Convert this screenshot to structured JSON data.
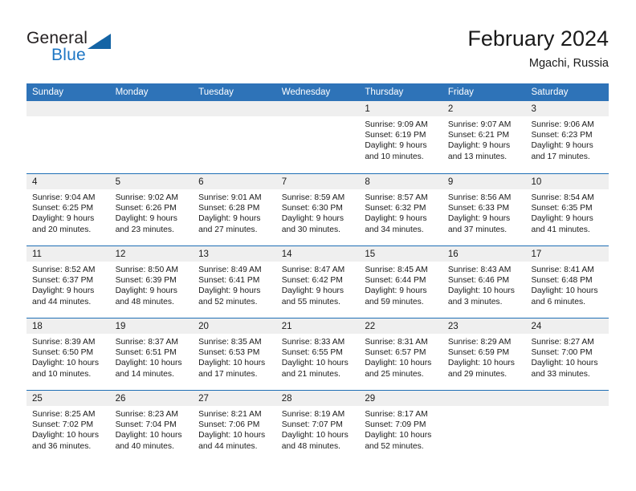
{
  "brand": {
    "name_part1": "General",
    "name_part2": "Blue",
    "triangle_icon": "triangle-icon"
  },
  "header": {
    "title": "February 2024",
    "subtitle": "Mgachi, Russia"
  },
  "colors": {
    "header_blue": "#2e73b8",
    "divider_blue": "#1f6fb5",
    "day_strip_gray": "#efefef",
    "brand_blue": "#1d76c4",
    "text": "#1a1a1a"
  },
  "weekdays": [
    "Sunday",
    "Monday",
    "Tuesday",
    "Wednesday",
    "Thursday",
    "Friday",
    "Saturday"
  ],
  "weeks": [
    [
      {
        "day": "",
        "empty": true,
        "sunrise": "",
        "sunset": "",
        "daylight_line1": "",
        "daylight_line2": ""
      },
      {
        "day": "",
        "empty": true,
        "sunrise": "",
        "sunset": "",
        "daylight_line1": "",
        "daylight_line2": ""
      },
      {
        "day": "",
        "empty": true,
        "sunrise": "",
        "sunset": "",
        "daylight_line1": "",
        "daylight_line2": ""
      },
      {
        "day": "",
        "empty": true,
        "sunrise": "",
        "sunset": "",
        "daylight_line1": "",
        "daylight_line2": ""
      },
      {
        "day": "1",
        "sunrise": "Sunrise: 9:09 AM",
        "sunset": "Sunset: 6:19 PM",
        "daylight_line1": "Daylight: 9 hours",
        "daylight_line2": "and 10 minutes."
      },
      {
        "day": "2",
        "sunrise": "Sunrise: 9:07 AM",
        "sunset": "Sunset: 6:21 PM",
        "daylight_line1": "Daylight: 9 hours",
        "daylight_line2": "and 13 minutes."
      },
      {
        "day": "3",
        "sunrise": "Sunrise: 9:06 AM",
        "sunset": "Sunset: 6:23 PM",
        "daylight_line1": "Daylight: 9 hours",
        "daylight_line2": "and 17 minutes."
      }
    ],
    [
      {
        "day": "4",
        "sunrise": "Sunrise: 9:04 AM",
        "sunset": "Sunset: 6:25 PM",
        "daylight_line1": "Daylight: 9 hours",
        "daylight_line2": "and 20 minutes."
      },
      {
        "day": "5",
        "sunrise": "Sunrise: 9:02 AM",
        "sunset": "Sunset: 6:26 PM",
        "daylight_line1": "Daylight: 9 hours",
        "daylight_line2": "and 23 minutes."
      },
      {
        "day": "6",
        "sunrise": "Sunrise: 9:01 AM",
        "sunset": "Sunset: 6:28 PM",
        "daylight_line1": "Daylight: 9 hours",
        "daylight_line2": "and 27 minutes."
      },
      {
        "day": "7",
        "sunrise": "Sunrise: 8:59 AM",
        "sunset": "Sunset: 6:30 PM",
        "daylight_line1": "Daylight: 9 hours",
        "daylight_line2": "and 30 minutes."
      },
      {
        "day": "8",
        "sunrise": "Sunrise: 8:57 AM",
        "sunset": "Sunset: 6:32 PM",
        "daylight_line1": "Daylight: 9 hours",
        "daylight_line2": "and 34 minutes."
      },
      {
        "day": "9",
        "sunrise": "Sunrise: 8:56 AM",
        "sunset": "Sunset: 6:33 PM",
        "daylight_line1": "Daylight: 9 hours",
        "daylight_line2": "and 37 minutes."
      },
      {
        "day": "10",
        "sunrise": "Sunrise: 8:54 AM",
        "sunset": "Sunset: 6:35 PM",
        "daylight_line1": "Daylight: 9 hours",
        "daylight_line2": "and 41 minutes."
      }
    ],
    [
      {
        "day": "11",
        "sunrise": "Sunrise: 8:52 AM",
        "sunset": "Sunset: 6:37 PM",
        "daylight_line1": "Daylight: 9 hours",
        "daylight_line2": "and 44 minutes."
      },
      {
        "day": "12",
        "sunrise": "Sunrise: 8:50 AM",
        "sunset": "Sunset: 6:39 PM",
        "daylight_line1": "Daylight: 9 hours",
        "daylight_line2": "and 48 minutes."
      },
      {
        "day": "13",
        "sunrise": "Sunrise: 8:49 AM",
        "sunset": "Sunset: 6:41 PM",
        "daylight_line1": "Daylight: 9 hours",
        "daylight_line2": "and 52 minutes."
      },
      {
        "day": "14",
        "sunrise": "Sunrise: 8:47 AM",
        "sunset": "Sunset: 6:42 PM",
        "daylight_line1": "Daylight: 9 hours",
        "daylight_line2": "and 55 minutes."
      },
      {
        "day": "15",
        "sunrise": "Sunrise: 8:45 AM",
        "sunset": "Sunset: 6:44 PM",
        "daylight_line1": "Daylight: 9 hours",
        "daylight_line2": "and 59 minutes."
      },
      {
        "day": "16",
        "sunrise": "Sunrise: 8:43 AM",
        "sunset": "Sunset: 6:46 PM",
        "daylight_line1": "Daylight: 10 hours",
        "daylight_line2": "and 3 minutes."
      },
      {
        "day": "17",
        "sunrise": "Sunrise: 8:41 AM",
        "sunset": "Sunset: 6:48 PM",
        "daylight_line1": "Daylight: 10 hours",
        "daylight_line2": "and 6 minutes."
      }
    ],
    [
      {
        "day": "18",
        "sunrise": "Sunrise: 8:39 AM",
        "sunset": "Sunset: 6:50 PM",
        "daylight_line1": "Daylight: 10 hours",
        "daylight_line2": "and 10 minutes."
      },
      {
        "day": "19",
        "sunrise": "Sunrise: 8:37 AM",
        "sunset": "Sunset: 6:51 PM",
        "daylight_line1": "Daylight: 10 hours",
        "daylight_line2": "and 14 minutes."
      },
      {
        "day": "20",
        "sunrise": "Sunrise: 8:35 AM",
        "sunset": "Sunset: 6:53 PM",
        "daylight_line1": "Daylight: 10 hours",
        "daylight_line2": "and 17 minutes."
      },
      {
        "day": "21",
        "sunrise": "Sunrise: 8:33 AM",
        "sunset": "Sunset: 6:55 PM",
        "daylight_line1": "Daylight: 10 hours",
        "daylight_line2": "and 21 minutes."
      },
      {
        "day": "22",
        "sunrise": "Sunrise: 8:31 AM",
        "sunset": "Sunset: 6:57 PM",
        "daylight_line1": "Daylight: 10 hours",
        "daylight_line2": "and 25 minutes."
      },
      {
        "day": "23",
        "sunrise": "Sunrise: 8:29 AM",
        "sunset": "Sunset: 6:59 PM",
        "daylight_line1": "Daylight: 10 hours",
        "daylight_line2": "and 29 minutes."
      },
      {
        "day": "24",
        "sunrise": "Sunrise: 8:27 AM",
        "sunset": "Sunset: 7:00 PM",
        "daylight_line1": "Daylight: 10 hours",
        "daylight_line2": "and 33 minutes."
      }
    ],
    [
      {
        "day": "25",
        "sunrise": "Sunrise: 8:25 AM",
        "sunset": "Sunset: 7:02 PM",
        "daylight_line1": "Daylight: 10 hours",
        "daylight_line2": "and 36 minutes."
      },
      {
        "day": "26",
        "sunrise": "Sunrise: 8:23 AM",
        "sunset": "Sunset: 7:04 PM",
        "daylight_line1": "Daylight: 10 hours",
        "daylight_line2": "and 40 minutes."
      },
      {
        "day": "27",
        "sunrise": "Sunrise: 8:21 AM",
        "sunset": "Sunset: 7:06 PM",
        "daylight_line1": "Daylight: 10 hours",
        "daylight_line2": "and 44 minutes."
      },
      {
        "day": "28",
        "sunrise": "Sunrise: 8:19 AM",
        "sunset": "Sunset: 7:07 PM",
        "daylight_line1": "Daylight: 10 hours",
        "daylight_line2": "and 48 minutes."
      },
      {
        "day": "29",
        "sunrise": "Sunrise: 8:17 AM",
        "sunset": "Sunset: 7:09 PM",
        "daylight_line1": "Daylight: 10 hours",
        "daylight_line2": "and 52 minutes."
      },
      {
        "day": "",
        "empty": true,
        "sunrise": "",
        "sunset": "",
        "daylight_line1": "",
        "daylight_line2": ""
      },
      {
        "day": "",
        "empty": true,
        "sunrise": "",
        "sunset": "",
        "daylight_line1": "",
        "daylight_line2": ""
      }
    ]
  ]
}
